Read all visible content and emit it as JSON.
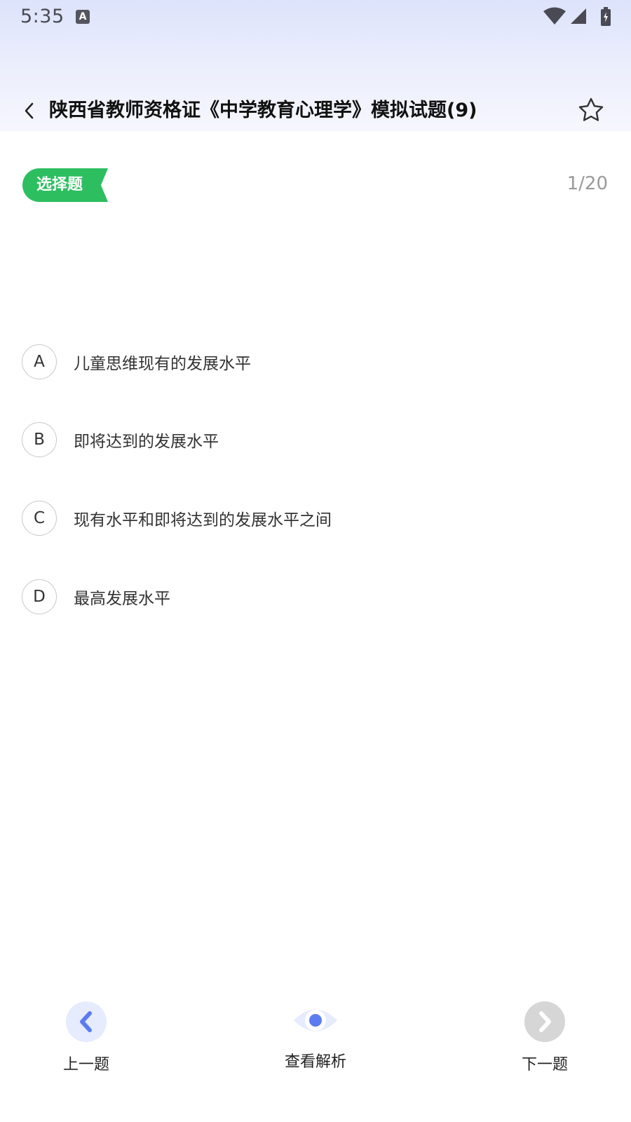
{
  "status_bar": {
    "time": "5:35",
    "app_icon_glyph": "A",
    "icons": [
      "wifi-icon",
      "cell-signal-icon",
      "battery-icon"
    ]
  },
  "header": {
    "back_icon": "chevron-left-icon",
    "title": "陕西省教师资格证《中学教育心理学》模拟试题(9)",
    "favorite_icon": "star-outline-icon"
  },
  "question": {
    "type_tag": "选择题",
    "progress": "1/20",
    "options": [
      {
        "letter": "A",
        "text": "儿童思维现有的发展水平"
      },
      {
        "letter": "B",
        "text": "即将达到的发展水平"
      },
      {
        "letter": "C",
        "text": "现有水平和即将达到的发展水平之间"
      },
      {
        "letter": "D",
        "text": "最高发展水平"
      }
    ]
  },
  "bottom_nav": {
    "prev_label": "上一题",
    "analysis_label": "查看解析",
    "next_label": "下一题"
  },
  "colors": {
    "accent_green": "#2dbe60",
    "accent_blue": "#5b7cf0",
    "disabled_gray": "#d6d6d6"
  }
}
